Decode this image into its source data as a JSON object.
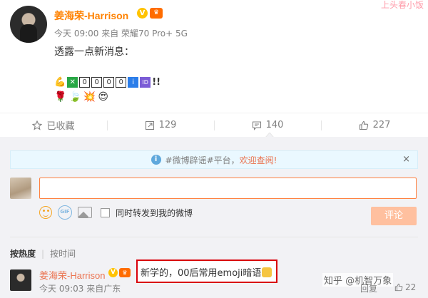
{
  "post": {
    "author": "姜海荣-Harrison",
    "v_badge": "V",
    "vip_badge": "♛",
    "meta": "今天 09:00 来自 荣耀70 Pro+ 5G",
    "text": "透露一点新消息：",
    "corner_deco": "上头春小饭",
    "emoji_row1": {
      "boxes": [
        "0",
        "0",
        "0",
        "0"
      ],
      "info_box": "i",
      "id_box": "ID",
      "suffix": "!!"
    }
  },
  "actions": {
    "favorite": "已收藏",
    "repost": "129",
    "comment": "140",
    "like": "227"
  },
  "comments": {
    "notice_prefix": "#微博辟谣#平台，",
    "notice_link": "欢迎查阅!",
    "notice_close": "×",
    "gif_label": "GIF",
    "sync_label": "同时转发到我的微博",
    "submit_label": "评论",
    "sort_hot": "按热度",
    "sort_time": "按时间",
    "comment": {
      "author": "姜海荣-Harrison",
      "text": "新学的，00后常用emoji暗语",
      "time": "今天 09:03 来自广东",
      "reply": "回复",
      "likes": "22"
    },
    "watermark": "知乎 @机智万象"
  },
  "colors": {
    "accent": "#ff8200",
    "link": "#eb7350",
    "highlight_border": "#d9000b"
  }
}
